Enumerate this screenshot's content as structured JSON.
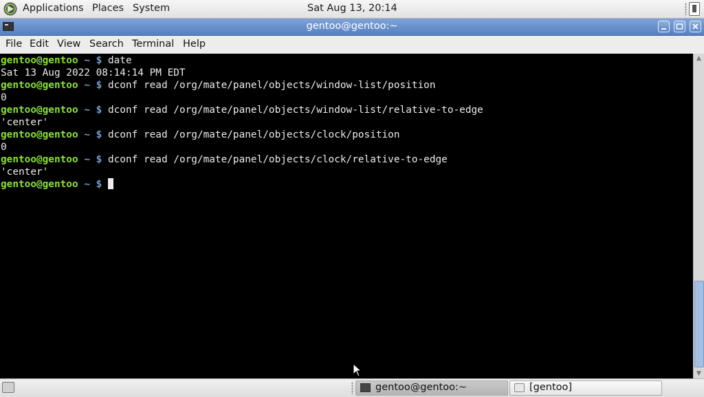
{
  "top_panel": {
    "menus": [
      "Applications",
      "Places",
      "System"
    ],
    "clock": "Sat Aug 13, 20:14"
  },
  "window": {
    "title": "gentoo@gentoo:~"
  },
  "menubar": [
    "File",
    "Edit",
    "View",
    "Search",
    "Terminal",
    "Help"
  ],
  "terminal": {
    "prompt_user": "gentoo@gentoo",
    "prompt_path": "~ $",
    "lines": [
      {
        "type": "cmd",
        "text": "date"
      },
      {
        "type": "out",
        "text": "Sat 13 Aug 2022 08:14:14 PM EDT"
      },
      {
        "type": "cmd",
        "text": "dconf read /org/mate/panel/objects/window-list/position"
      },
      {
        "type": "out",
        "text": "0"
      },
      {
        "type": "cmd",
        "text": "dconf read /org/mate/panel/objects/window-list/relative-to-edge"
      },
      {
        "type": "out",
        "text": "'center'"
      },
      {
        "type": "cmd",
        "text": "dconf read /org/mate/panel/objects/clock/position"
      },
      {
        "type": "out",
        "text": "0"
      },
      {
        "type": "cmd",
        "text": "dconf read /org/mate/panel/objects/clock/relative-to-edge"
      },
      {
        "type": "out",
        "text": "'center'"
      },
      {
        "type": "cmd",
        "text": "",
        "cursor": true
      }
    ]
  },
  "taskbar": {
    "tasks": [
      {
        "label": "gentoo@gentoo:~",
        "active": true
      },
      {
        "label": "[gentoo]",
        "active": false
      }
    ]
  }
}
